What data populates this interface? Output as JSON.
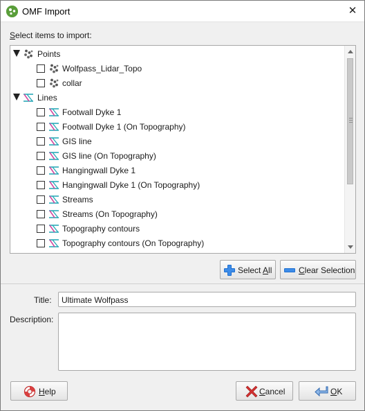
{
  "window": {
    "title": "OMF Import"
  },
  "tree_label": {
    "before": "",
    "mnemonic": "S",
    "after": "elect items to import:"
  },
  "tree": [
    {
      "kind": "group",
      "label": "Points",
      "icon": "points-icon"
    },
    {
      "kind": "item",
      "label": "Wolfpass_Lidar_Topo",
      "icon": "points-icon",
      "checked": false
    },
    {
      "kind": "item",
      "label": "collar",
      "icon": "points-icon",
      "checked": false
    },
    {
      "kind": "group",
      "label": "Lines",
      "icon": "lines-icon"
    },
    {
      "kind": "item",
      "label": "Footwall Dyke 1",
      "icon": "lines-icon",
      "checked": false
    },
    {
      "kind": "item",
      "label": "Footwall Dyke 1 (On Topography)",
      "icon": "lines-icon",
      "checked": false
    },
    {
      "kind": "item",
      "label": "GIS line",
      "icon": "lines-icon",
      "checked": false
    },
    {
      "kind": "item",
      "label": "GIS line (On Topography)",
      "icon": "lines-icon",
      "checked": false
    },
    {
      "kind": "item",
      "label": "Hangingwall Dyke 1",
      "icon": "lines-icon",
      "checked": false
    },
    {
      "kind": "item",
      "label": "Hangingwall Dyke 1 (On Topography)",
      "icon": "lines-icon",
      "checked": false
    },
    {
      "kind": "item",
      "label": "Streams",
      "icon": "lines-icon",
      "checked": false
    },
    {
      "kind": "item",
      "label": "Streams (On Topography)",
      "icon": "lines-icon",
      "checked": false
    },
    {
      "kind": "item",
      "label": "Topography contours",
      "icon": "lines-icon",
      "checked": false
    },
    {
      "kind": "item",
      "label": "Topography contours (On Topography)",
      "icon": "lines-icon",
      "checked": false
    },
    {
      "kind": "item",
      "label": "",
      "icon": "lines-icon",
      "checked": false
    }
  ],
  "buttons": {
    "select_all": {
      "before": "Select ",
      "mnemonic": "A",
      "after": "ll",
      "icon": "plus-icon"
    },
    "clear_selection": {
      "before": "",
      "mnemonic": "C",
      "after": "lear Selection",
      "icon": "minus-icon"
    },
    "help": {
      "before": "",
      "mnemonic": "H",
      "after": "elp",
      "icon": "lifebuoy-icon"
    },
    "cancel": {
      "before": "",
      "mnemonic": "C",
      "after": "ancel",
      "icon": "red-x-icon"
    },
    "ok": {
      "before": "",
      "mnemonic": "O",
      "after": "K",
      "icon": "enter-arrow-icon"
    }
  },
  "form": {
    "title_label": "Title:",
    "title_value": "Ultimate Wolfpass",
    "description_label": "Description:",
    "description_value": ""
  },
  "colors": {
    "accent_blue": "#1f6fd0",
    "lines_teal": "#2aa8b8",
    "lines_pink": "#d24aa0",
    "cancel_red": "#d23030",
    "app_green": "#5a9e3a"
  }
}
